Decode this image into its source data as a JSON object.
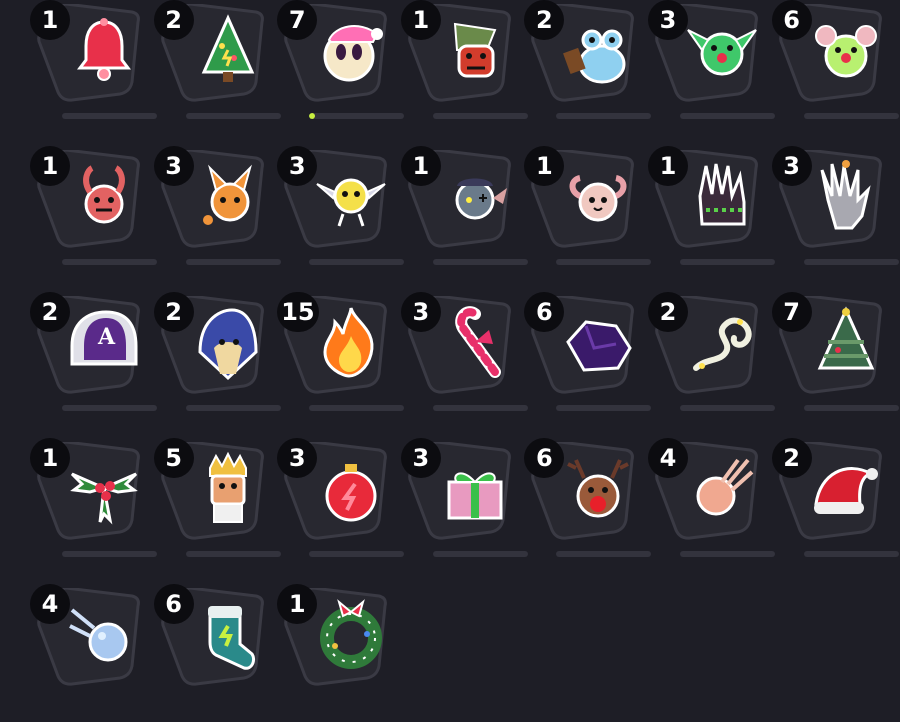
{
  "colors": {
    "background": "#1e1e26",
    "slot_fill": "#282830",
    "slot_stroke": "#3a3a44",
    "badge_bg": "#0c0c10",
    "badge_text": "#ffffff",
    "progress_track": "#33333d",
    "progress_fill": "#c8f040"
  },
  "items": [
    {
      "icon": "bell-icon",
      "count": "1",
      "progress": 0,
      "show_progress": true
    },
    {
      "icon": "christmas-tree-icon",
      "count": "2",
      "progress": 0,
      "show_progress": true
    },
    {
      "icon": "santa-face-icon",
      "count": "7",
      "progress": 0.06,
      "show_progress": true
    },
    {
      "icon": "green-hat-face-icon",
      "count": "1",
      "progress": 0,
      "show_progress": true
    },
    {
      "icon": "snow-frog-icon",
      "count": "2",
      "progress": 0,
      "show_progress": true
    },
    {
      "icon": "green-goblin-icon",
      "count": "3",
      "progress": 0,
      "show_progress": true
    },
    {
      "icon": "green-mouse-icon",
      "count": "6",
      "progress": 0,
      "show_progress": true
    },
    {
      "icon": "red-imp-icon",
      "count": "1",
      "progress": 0,
      "show_progress": true
    },
    {
      "icon": "orange-fox-icon",
      "count": "3",
      "progress": 0,
      "show_progress": true
    },
    {
      "icon": "yellow-sprite-icon",
      "count": "3",
      "progress": 0,
      "show_progress": true
    },
    {
      "icon": "stitched-zombie-icon",
      "count": "1",
      "progress": 0,
      "show_progress": true
    },
    {
      "icon": "pink-ram-icon",
      "count": "1",
      "progress": 0,
      "show_progress": true
    },
    {
      "icon": "dark-glove-icon",
      "count": "1",
      "progress": 0,
      "show_progress": true
    },
    {
      "icon": "grey-hand-icon",
      "count": "3",
      "progress": 0,
      "show_progress": true
    },
    {
      "icon": "purple-cap-icon",
      "count": "2",
      "progress": 0,
      "show_progress": true
    },
    {
      "icon": "hooded-wizard-icon",
      "count": "2",
      "progress": 0,
      "show_progress": true
    },
    {
      "icon": "fire-icon",
      "count": "15",
      "progress": 0,
      "show_progress": true
    },
    {
      "icon": "candy-cane-icon",
      "count": "3",
      "progress": 0,
      "show_progress": true
    },
    {
      "icon": "purple-rock-icon",
      "count": "6",
      "progress": 0,
      "show_progress": true
    },
    {
      "icon": "white-vine-icon",
      "count": "2",
      "progress": 0,
      "show_progress": true
    },
    {
      "icon": "decorated-tree-icon",
      "count": "7",
      "progress": 0,
      "show_progress": true
    },
    {
      "icon": "holly-icon",
      "count": "1",
      "progress": 0,
      "show_progress": true
    },
    {
      "icon": "nutcracker-icon",
      "count": "5",
      "progress": 0,
      "show_progress": true
    },
    {
      "icon": "red-ornament-icon",
      "count": "3",
      "progress": 0,
      "show_progress": true
    },
    {
      "icon": "gift-box-icon",
      "count": "3",
      "progress": 0,
      "show_progress": true
    },
    {
      "icon": "reindeer-icon",
      "count": "6",
      "progress": 0,
      "show_progress": true
    },
    {
      "icon": "peach-comet-icon",
      "count": "4",
      "progress": 0,
      "show_progress": true
    },
    {
      "icon": "santa-hat-icon",
      "count": "2",
      "progress": 0,
      "show_progress": true
    },
    {
      "icon": "snowball-icon",
      "count": "4",
      "progress": 0,
      "show_progress": false
    },
    {
      "icon": "stocking-icon",
      "count": "6",
      "progress": 0,
      "show_progress": false
    },
    {
      "icon": "wreath-icon",
      "count": "1",
      "progress": 0,
      "show_progress": false
    }
  ]
}
